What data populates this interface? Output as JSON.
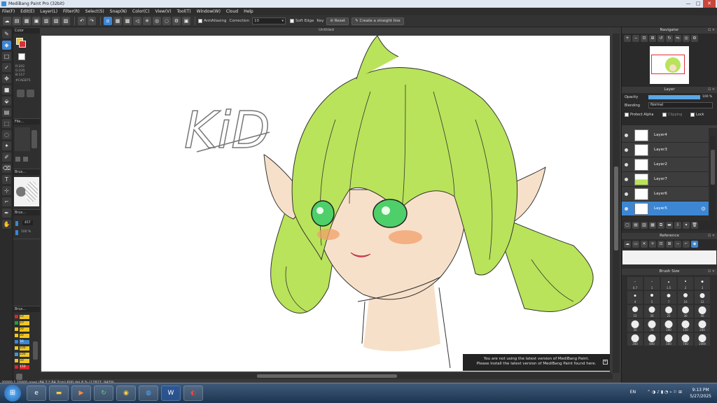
{
  "window": {
    "title": "MediBang Paint Pro (32bit)",
    "controls": [
      "—",
      "□",
      "✕"
    ]
  },
  "menu": [
    "File(F)",
    "Edit(E)",
    "Layer(L)",
    "Filter(R)",
    "Select(S)",
    "Snap(N)",
    "Color(C)",
    "View(V)",
    "Tool(T)",
    "Window(W)",
    "Cloud",
    "Help"
  ],
  "toolbar": {
    "antialiasing": "AntiAliasing",
    "correction_label": "Correction",
    "correction_value": "10",
    "soft_edge": "Soft Edge",
    "key": "Key",
    "reset": "Reset",
    "straight_line": "Create a straight line"
  },
  "canvas": {
    "tab_title": "Untitled",
    "sketch_text": "KiD"
  },
  "left": {
    "color_head": "Color",
    "color_values": [
      "R:202",
      "G:235",
      "B:117"
    ],
    "color_hex": "#CAEB75",
    "file_head": "File...",
    "brush_head": "Brus...",
    "brush_head2": "Brus...",
    "brush_width": "457",
    "opacity": "100 %",
    "brush_list_head": "Brus...",
    "brush_list": [
      "10",
      "10",
      "50",
      "50",
      "50",
      "100",
      "100",
      "50",
      "150"
    ]
  },
  "navigator": {
    "title": "Navigator"
  },
  "layer": {
    "title": "Layer",
    "opacity_label": "Opacity",
    "opacity_value": "100 %",
    "blending_label": "Blending",
    "blending_value": "Normal",
    "protect_alpha": "Protect Alpha",
    "clipping": "Clipping",
    "lock": "Lock",
    "layers": [
      "Layer4",
      "Layer3",
      "Layer2",
      "Layer7",
      "Layer6",
      "Layer5"
    ]
  },
  "reference": {
    "title": "Reference"
  },
  "brush_size": {
    "title": "Brush Size",
    "sizes": [
      "0.7",
      "1",
      "1.5",
      "2",
      "3",
      "4",
      "5",
      "7",
      "10",
      "12",
      "15",
      "20",
      "25",
      "30",
      "40",
      "50",
      "70",
      "100",
      "150",
      "200",
      "300",
      "400",
      "500",
      "700",
      "1000"
    ]
  },
  "notice": {
    "line1": "You are not using the latest version of MediBang Paint.",
    "line2": "Please install the latest version of MediBang Paint found here."
  },
  "status": {
    "text": "20000 * 20000 pixel  (84.7 * 84.7cm)  600 dpi  8 %  (17827, 9439)"
  },
  "taskbar": {
    "lang": "EN",
    "time": "9:13 PM",
    "date": "5/27/2025"
  },
  "colors": {
    "hair": "#b9e35a",
    "eye": "#4fcf6a",
    "skin": "#f7e0c9",
    "blush": "#f2a06b",
    "accent": "#3c86d4"
  }
}
